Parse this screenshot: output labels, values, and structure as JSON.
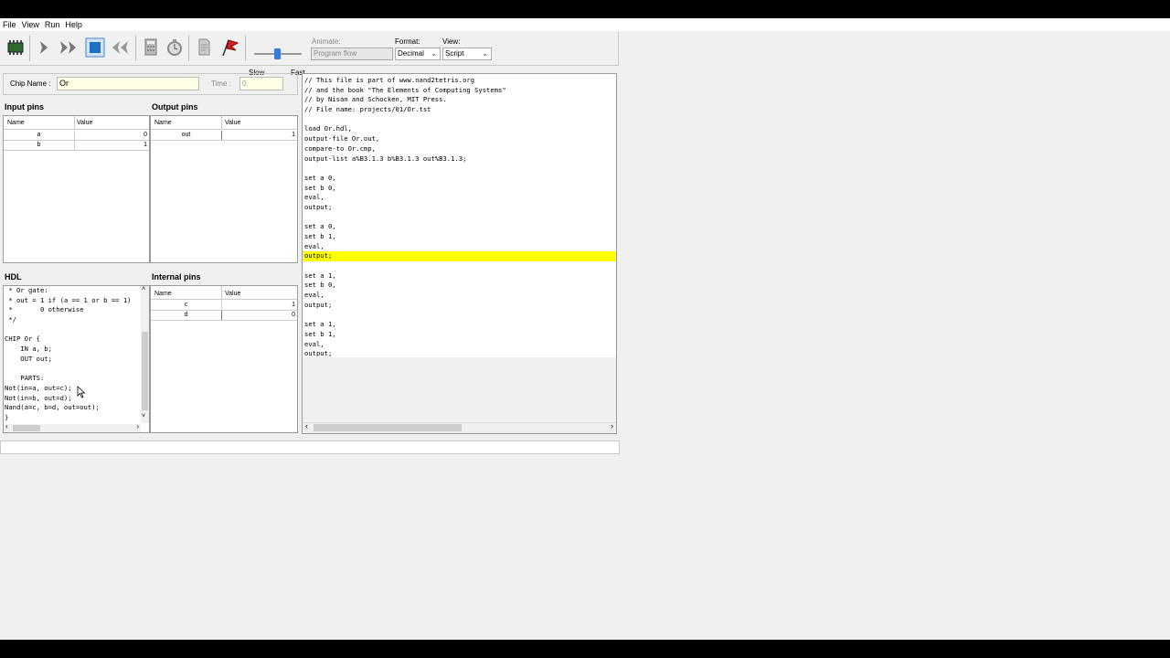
{
  "menu": [
    "File",
    "View",
    "Run",
    "Help"
  ],
  "toolbar": {
    "buttons": [
      "load-chip",
      "single-step",
      "run",
      "stop",
      "reset",
      "eval",
      "clock",
      "load-script",
      "breakpoint"
    ],
    "slow_label": "Slow",
    "fast_label": "Fast",
    "animate_label": "Animate:",
    "animate_value": "Program flow",
    "format_label": "Format:",
    "format_value": "Decimal",
    "view_label": "View:",
    "view_value": "Script"
  },
  "chip": {
    "name_label": "Chip Name :",
    "name_value": "Or",
    "time_label": "Time :",
    "time_value": "0"
  },
  "input_pins": {
    "title": "Input pins",
    "headers": [
      "Name",
      "Value"
    ],
    "rows": [
      {
        "name": "a",
        "value": "0"
      },
      {
        "name": "b",
        "value": "1"
      }
    ]
  },
  "output_pins": {
    "title": "Output pins",
    "headers": [
      "Name",
      "Value"
    ],
    "rows": [
      {
        "name": "out",
        "value": "1"
      }
    ]
  },
  "internal_pins": {
    "title": "Internal pins",
    "headers": [
      "Name",
      "Value"
    ],
    "rows": [
      {
        "name": "c",
        "value": "1"
      },
      {
        "name": "d",
        "value": "0"
      }
    ]
  },
  "hdl": {
    "title": "HDL",
    "lines": [
      " * Or gate:",
      " * out = 1 if (a == 1 or b == 1)",
      " *       0 otherwise",
      " */",
      "",
      "CHIP Or {",
      "    IN a, b;",
      "    OUT out;",
      "",
      "    PARTS:",
      "Not(in=a, out=c);",
      "Not(in=b, out=d);",
      "Nand(a=c, b=d, out=out);",
      "}"
    ]
  },
  "script": {
    "lines": [
      "// This file is part of www.nand2tetris.org",
      "// and the book \"The Elements of Computing Systems\"",
      "// by Nisan and Schocken, MIT Press.",
      "// File name: projects/01/Or.tst",
      "",
      "load Or.hdl,",
      "output-file Or.out,",
      "compare-to Or.cmp,",
      "output-list a%B3.1.3 b%B3.1.3 out%B3.1.3;",
      "",
      "set a 0,",
      "set b 0,",
      "eval,",
      "output;",
      "",
      "set a 0,",
      "set b 1,",
      "eval,",
      "output;",
      "",
      "set a 1,",
      "set b 0,",
      "eval,",
      "output;",
      "",
      "set a 1,",
      "set b 1,",
      "eval,",
      "output;"
    ],
    "highlight_index": 18
  },
  "colors": {
    "highlight": "#ffff00",
    "chip_field_bg": "#ffffe6",
    "accent": "#3a7bd5"
  }
}
